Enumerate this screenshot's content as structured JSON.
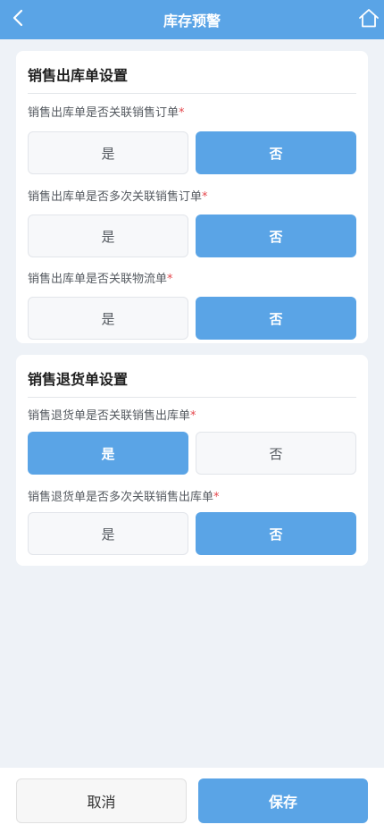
{
  "header": {
    "title": "库存预警",
    "back_icon": "chevron-left-icon",
    "home_icon": "home-icon"
  },
  "sections": [
    {
      "title": "销售出库单设置",
      "questions": [
        {
          "label": "销售出库单是否关联销售订单",
          "required_mark": "*",
          "yes": "是",
          "no": "否",
          "selected": "否"
        },
        {
          "label": "销售出库单是否多次关联销售订单",
          "required_mark": "*",
          "yes": "是",
          "no": "否",
          "selected": "否"
        },
        {
          "label": "销售出库单是否关联物流单",
          "required_mark": "*",
          "yes": "是",
          "no": "否",
          "selected": "否"
        }
      ]
    },
    {
      "title": "销售退货单设置",
      "questions": [
        {
          "label": "销售退货单是否关联销售出库单",
          "required_mark": "*",
          "yes": "是",
          "no": "否",
          "selected": "是"
        },
        {
          "label": "销售退货单是否多次关联销售出库单",
          "required_mark": "*",
          "yes": "是",
          "no": "否",
          "selected": "否"
        }
      ]
    }
  ],
  "footer": {
    "cancel_label": "取消",
    "save_label": "保存"
  },
  "colors": {
    "primary": "#5aa4e6",
    "background": "#eef2f7",
    "required": "#e5484d"
  }
}
